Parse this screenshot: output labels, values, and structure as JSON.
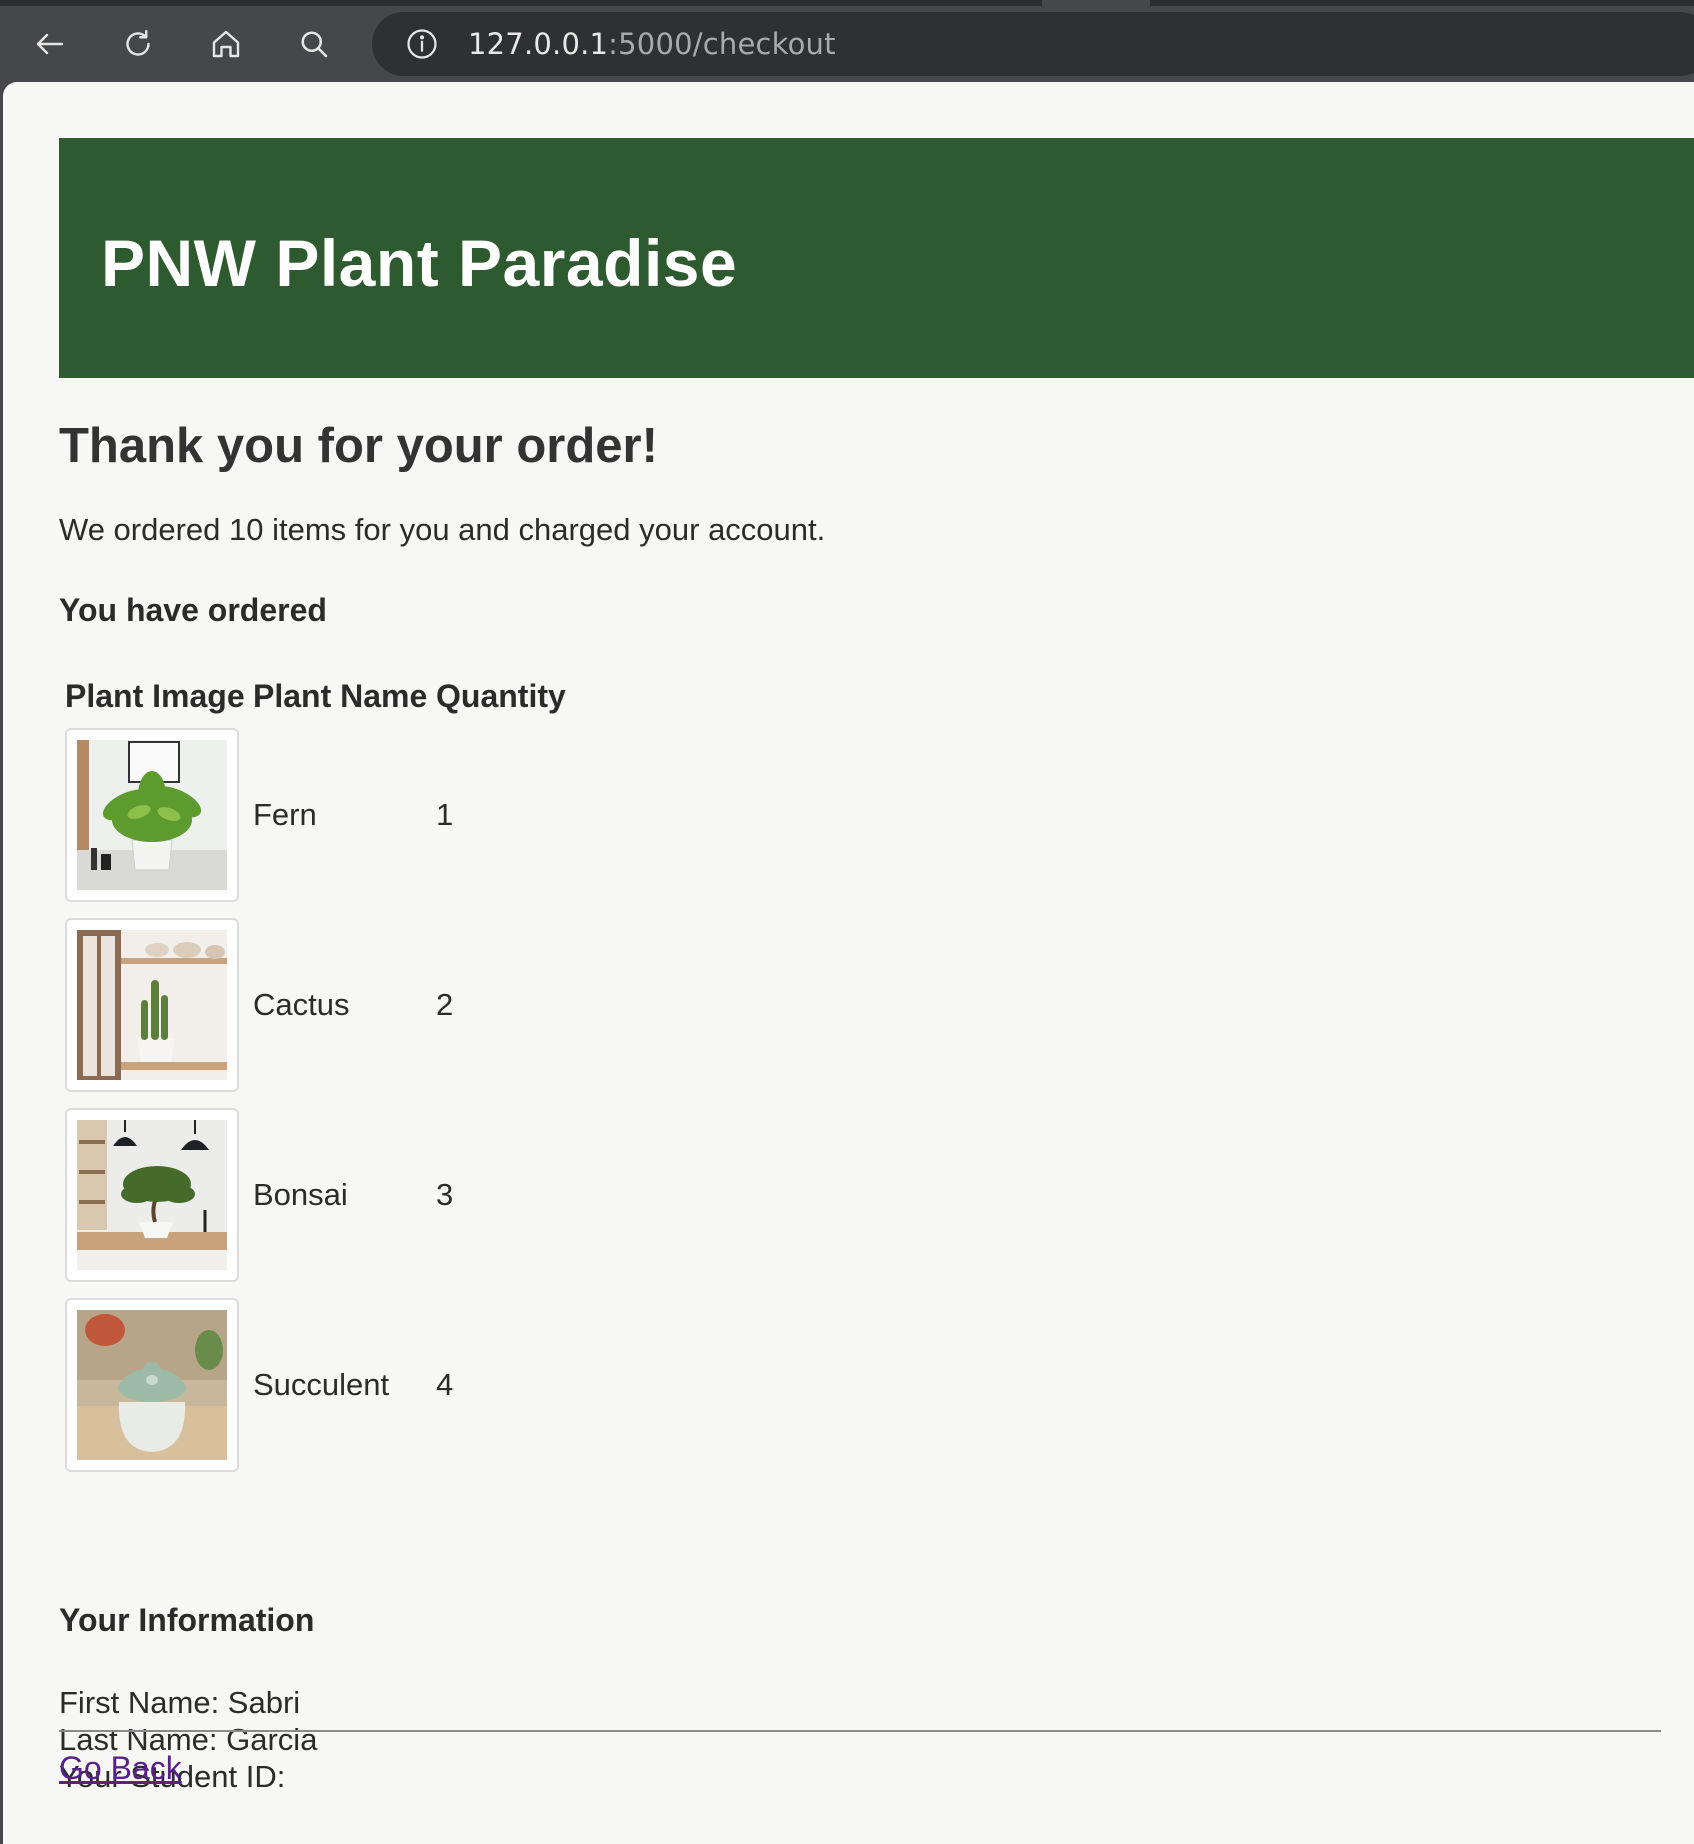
{
  "browser": {
    "url_host": "127.0.0.1",
    "url_path": ":5000/checkout",
    "icons": [
      "back-arrow-icon",
      "reload-icon",
      "home-icon",
      "search-icon",
      "site-info-icon"
    ]
  },
  "header": {
    "title": "PNW Plant Paradise",
    "background_color": "#2d5a2f"
  },
  "main": {
    "heading": "Thank you for your order!",
    "summary": "We ordered 10 items for you and charged your account.",
    "ordered_heading": "You have ordered",
    "table": {
      "columns": [
        "Plant Image",
        "Plant Name",
        "Quantity"
      ],
      "rows": [
        {
          "name": "Fern",
          "quantity": "1"
        },
        {
          "name": "Cactus",
          "quantity": "2"
        },
        {
          "name": "Bonsai",
          "quantity": "3"
        },
        {
          "name": "Succulent",
          "quantity": "4"
        }
      ]
    },
    "info_heading": "Your Information",
    "info": {
      "first_name": "First Name: Sabri",
      "last_name": "Last Name: Garcia",
      "student_id": "Your Student ID:"
    },
    "go_back": "Go Back",
    "link_color": "#5a1f88"
  }
}
